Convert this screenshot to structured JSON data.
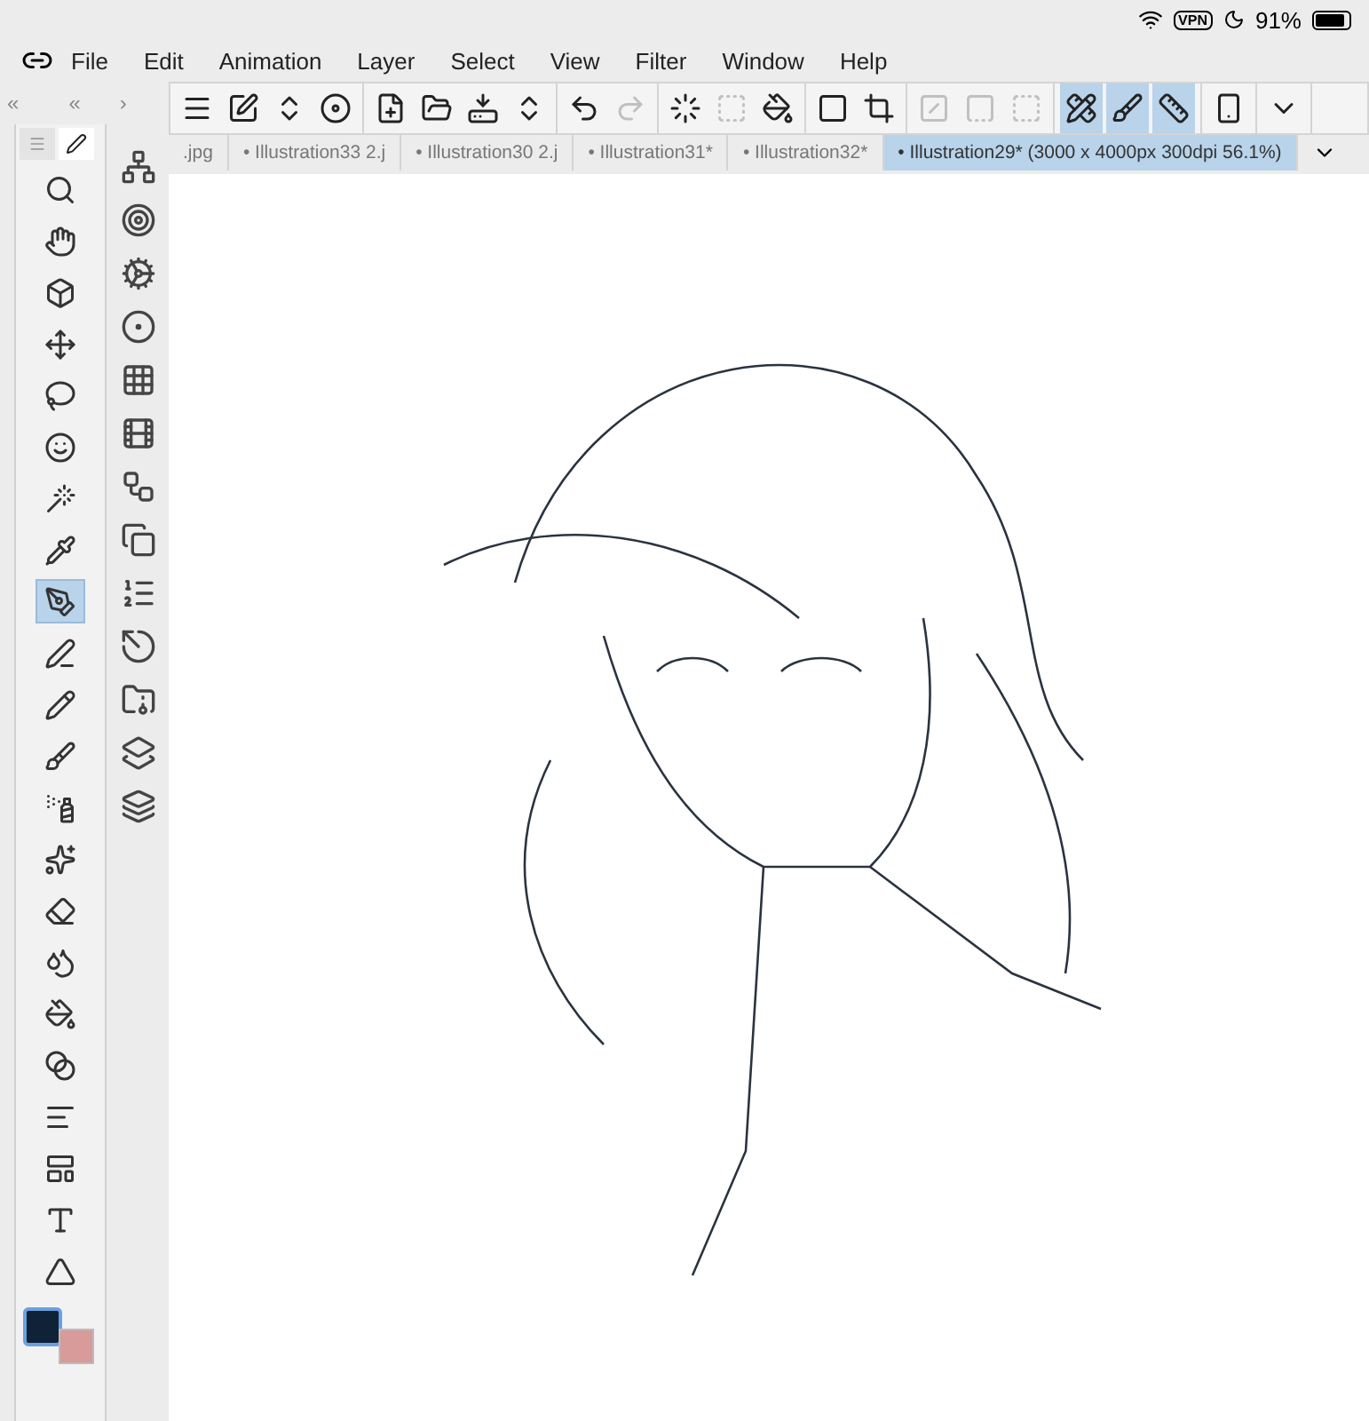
{
  "status_bar": {
    "vpn": "VPN",
    "battery": "91%"
  },
  "menu": [
    "File",
    "Edit",
    "Animation",
    "Layer",
    "Select",
    "View",
    "Filter",
    "Window",
    "Help"
  ],
  "panel_header": {
    "collapse_left": "«",
    "collapse_inner": "«",
    "expand": "›"
  },
  "toolbar_groups": [
    [
      {
        "selected": false,
        "disabled": false
      },
      {
        "selected": false,
        "disabled": false
      },
      {
        "selected": false,
        "disabled": false
      },
      {
        "selected": false,
        "disabled": false
      }
    ],
    [
      {
        "selected": false,
        "disabled": false
      },
      {
        "selected": false,
        "disabled": false
      },
      {
        "selected": false,
        "disabled": false
      },
      {
        "selected": false,
        "disabled": false
      }
    ],
    [
      {
        "selected": false,
        "disabled": false
      },
      {
        "selected": false,
        "disabled": true
      }
    ],
    [
      {
        "selected": false,
        "disabled": false
      },
      {
        "selected": false,
        "disabled": true
      },
      {
        "selected": false,
        "disabled": false
      }
    ],
    [
      {
        "selected": false,
        "disabled": false
      },
      {
        "selected": false,
        "disabled": false
      }
    ],
    [
      {
        "selected": false,
        "disabled": true
      },
      {
        "selected": false,
        "disabled": true
      },
      {
        "selected": false,
        "disabled": true
      }
    ],
    [
      {
        "selected": true,
        "disabled": false
      },
      {
        "selected": true,
        "disabled": false
      },
      {
        "selected": true,
        "disabled": false
      }
    ],
    [
      {
        "selected": false,
        "disabled": false
      }
    ],
    [
      {
        "selected": false,
        "disabled": false
      }
    ]
  ],
  "tabs": [
    {
      "label": ".jpg",
      "selected": false
    },
    {
      "label": "• Illustration33 2.j",
      "selected": false
    },
    {
      "label": "• Illustration30 2.j",
      "selected": false
    },
    {
      "label": "• Illustration31*",
      "selected": false
    },
    {
      "label": "• Illustration32*",
      "selected": false
    },
    {
      "label": "• Illustration29* (3000 x 4000px 300dpi 56.1%)",
      "selected": true
    }
  ],
  "tools": [
    {
      "selected": false
    },
    {
      "selected": false
    },
    {
      "selected": false
    },
    {
      "selected": false
    },
    {
      "selected": false
    },
    {
      "selected": false
    },
    {
      "selected": false
    },
    {
      "selected": false
    },
    {
      "selected": true
    },
    {
      "selected": false
    },
    {
      "selected": false
    },
    {
      "selected": false
    },
    {
      "selected": false
    },
    {
      "selected": false
    },
    {
      "selected": false
    },
    {
      "selected": false
    },
    {
      "selected": false
    },
    {
      "selected": false
    },
    {
      "selected": false
    },
    {
      "selected": false
    },
    {
      "selected": false
    },
    {
      "selected": false
    }
  ]
}
